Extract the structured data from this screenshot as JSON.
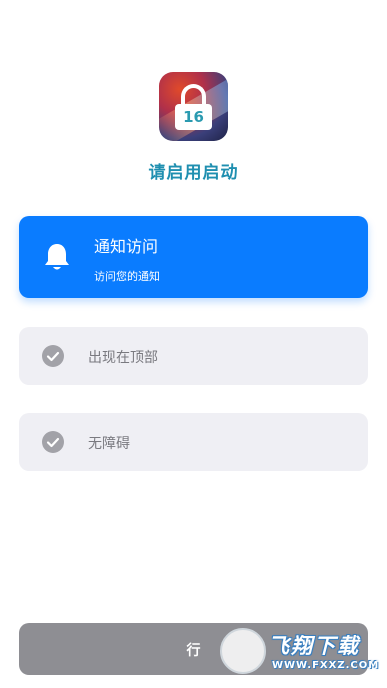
{
  "app_icon": {
    "badge_number": "16",
    "icon": "lock-icon"
  },
  "title": "请启用启动",
  "permissions": {
    "notification": {
      "title": "通知访问",
      "subtitle": "访问您的通知",
      "icon": "bell-icon",
      "active": true
    },
    "items": [
      {
        "label": "出现在顶部",
        "icon": "check-circle-icon"
      },
      {
        "label": "无障碍",
        "icon": "check-circle-icon"
      }
    ]
  },
  "bottom_button": {
    "label": "行"
  },
  "watermark": {
    "brand": "飞翔下载",
    "url": "WWW.FXXZ.COM"
  },
  "colors": {
    "accent": "#0a7cff",
    "title": "#1f8fb0",
    "card_grey": "#efeff4",
    "button_grey": "#8e8e93"
  }
}
